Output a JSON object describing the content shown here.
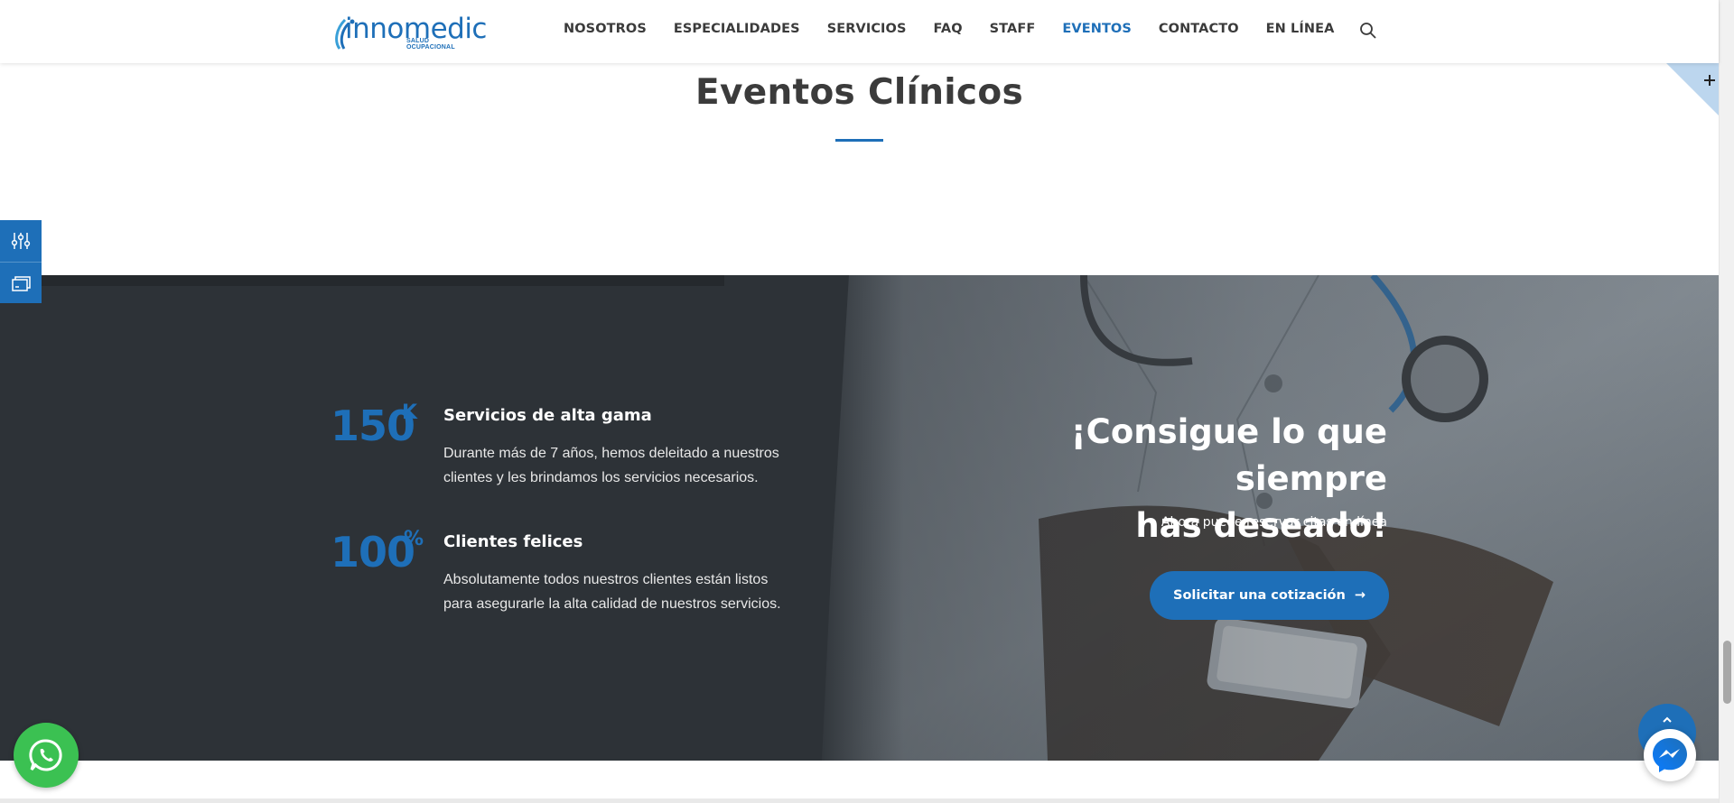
{
  "header": {
    "logo_text": "innomedic",
    "logo_sub": "SALUD OCUPACIONAL",
    "nav": [
      {
        "label": "NOSOTROS",
        "active": false
      },
      {
        "label": "ESPECIALIDADES",
        "active": false
      },
      {
        "label": "SERVICIOS",
        "active": false
      },
      {
        "label": "FAQ",
        "active": false
      },
      {
        "label": "STAFF",
        "active": false
      },
      {
        "label": "EVENTOS",
        "active": true
      },
      {
        "label": "CONTACTO",
        "active": false
      },
      {
        "label": "EN LÍNEA",
        "active": false
      }
    ],
    "search_icon": "search-icon"
  },
  "section": {
    "title": "Eventos Clínicos"
  },
  "stats": [
    {
      "number": "150",
      "suffix": "K",
      "title": "Servicios de alta gama",
      "description": "Durante más de 7 años, hemos deleitado a nuestros clientes y les brindamos los servicios necesarios."
    },
    {
      "number": "100",
      "suffix": "%",
      "title": "Clientes felices",
      "description": "Absolutamente todos nuestros clientes están listos para asegurarle la alta calidad de nuestros servicios."
    }
  ],
  "cta": {
    "title_line1": "¡Consigue lo que siempre",
    "title_line2": "has deseado!",
    "subtitle": "Ahora puede reservar citas en línea",
    "button_label": "Solicitar una cotización",
    "button_arrow": "→"
  },
  "colors": {
    "accent": "#1e6fb8",
    "dark_band": "#2d3237",
    "whatsapp": "#3bc152"
  }
}
